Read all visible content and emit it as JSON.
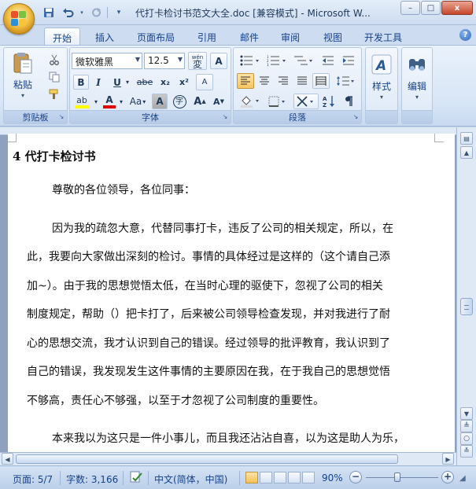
{
  "window": {
    "title": "代打卡检讨书范文大全.doc [兼容模式] - Microsoft W...",
    "controls": {
      "minimize": "–",
      "maximize": "□",
      "close": "x"
    }
  },
  "quick_access": [
    "save-icon",
    "undo-icon",
    "redo-icon",
    "customize-icon"
  ],
  "tabs": [
    {
      "label": "开始",
      "active": true
    },
    {
      "label": "插入"
    },
    {
      "label": "页面布局"
    },
    {
      "label": "引用"
    },
    {
      "label": "邮件"
    },
    {
      "label": "审阅"
    },
    {
      "label": "视图"
    },
    {
      "label": "开发工具"
    }
  ],
  "help_label": "?",
  "ribbon": {
    "clipboard": {
      "label": "剪贴板",
      "paste": "粘贴"
    },
    "font": {
      "label": "字体",
      "font_name": "微软雅黑",
      "font_size": "12.5",
      "phonetic": "wén",
      "phonetic_char": "変",
      "border_char": "A",
      "bold": "B",
      "italic": "I",
      "underline": "U",
      "strike": "abe",
      "subscript": "x₂",
      "superscript": "x²",
      "clear": "A",
      "case": "Aa",
      "shade": "A",
      "enclose": "字",
      "grow": "A",
      "shrink": "A"
    },
    "paragraph": {
      "label": "段落"
    },
    "styles": {
      "label": "样式"
    },
    "editing": {
      "label": "编辑"
    }
  },
  "document": {
    "heading": "4 代打卡检讨书",
    "greeting": "尊敬的各位领导，各位同事：",
    "lines": [
      "因为我的疏忽大意，代替同事打卡，违反了公司的相关规定，所以，在",
      "此，我要向大家做出深刻的检讨。事情的具体经过是这样的（这个请自己添",
      "加~）。由于我的思想觉悟太低，在当时心理的驱使下，忽视了公司的相关",
      "制度规定，帮助（）把卡打了，后来被公司领导检查发现，并对我进行了耐",
      "心的思想交流，我才认识到自己的错误。经过领导的批评教育，我认识到了",
      "自己的错误，我发现发生这件事情的主要原因在我，在于我自己的思想觉悟",
      "不够高，责任心不够强，以至于才忽视了公司制度的重要性。"
    ],
    "last_line": "本来我以为这只是一件小事儿，而且我还沾沾自喜，以为这是助人为乐，"
  },
  "status": {
    "page": "页面: 5/7",
    "words": "字数: 3,166",
    "language": "中文(简体，中国)",
    "zoom": "90%",
    "zoom_minus": "−",
    "zoom_plus": "+",
    "zoom_level": 90
  },
  "colors": {
    "highlight": "#ffff00",
    "font_color": "#e00000",
    "accent": "#15428b"
  }
}
